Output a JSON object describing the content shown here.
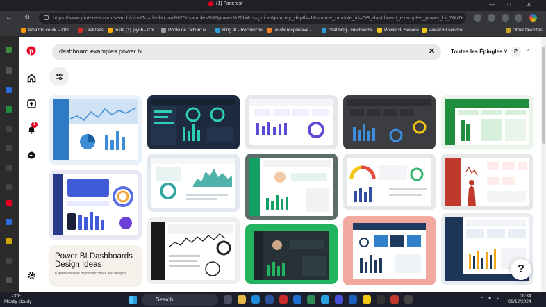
{
  "browser": {
    "tab_title": "(1) Pinterest",
    "url": "https://www.pinterest.com/search/pins/?q=dashboard%20examples%20power%20bi&rs=guide&journey_depth=1&source_module_id=OB_dashboard_examples_power_bi_76b7e...",
    "bookmarks": [
      {
        "label": "Amazon.co.uk – Onl...",
        "color": "#ff9900"
      },
      {
        "label": "LastPass",
        "color": "#d32d27"
      },
      {
        "label": "teste (1).ipynb - Col...",
        "color": "#f9ab00"
      },
      {
        "label": "Photo de l'album M...",
        "color": "#9e9e9e"
      },
      {
        "label": "Bing AI - Recherche",
        "color": "#2d9cdb"
      },
      {
        "label": "javafx responsive -...",
        "color": "#f48024"
      },
      {
        "label": "chat bing - Recherche",
        "color": "#2d9cdb"
      },
      {
        "label": "Power BI Service",
        "color": "#f2c811"
      },
      {
        "label": "Power BI service",
        "color": "#f2c811"
      }
    ],
    "other_favorites": "Other favorites"
  },
  "pinterest": {
    "search_query": "dashboard examples power bi",
    "pin_filter": "Toutes les Épingles",
    "avatar_initial": "P",
    "notification_count": "1",
    "help_label": "?",
    "pin_caption_title": "Power BI Dashboards Design Ideas",
    "pin_caption_sub": "Explore creative dashboard ideas and designs"
  },
  "taskbar": {
    "temperature": "73°F",
    "weather": "Mostly cloudy",
    "search_label": "Search",
    "time": "08:34",
    "date": "09/12/2024"
  },
  "colors": {
    "pinterest_red": "#e60023",
    "accent_green": "#1aa260",
    "accent_dark": "#1e2a3a"
  }
}
